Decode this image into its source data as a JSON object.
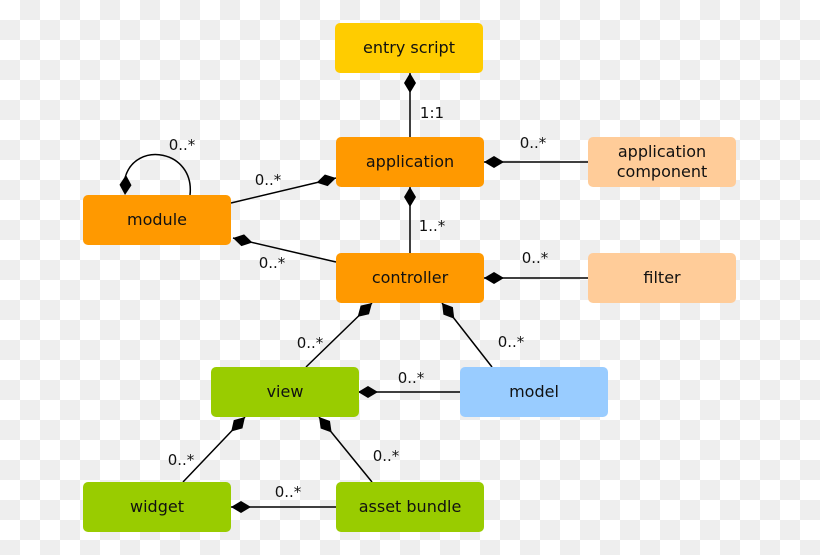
{
  "nodes": [
    {
      "id": "entry",
      "label": "entry script",
      "color": "#ffcc00"
    },
    {
      "id": "application",
      "label": "application",
      "color": "#ff9900"
    },
    {
      "id": "appcomp",
      "label": "application\ncomponent",
      "color": "#ffcc99"
    },
    {
      "id": "module",
      "label": "module",
      "color": "#ff9900"
    },
    {
      "id": "controller",
      "label": "controller",
      "color": "#ff9900"
    },
    {
      "id": "filter",
      "label": "filter",
      "color": "#ffcc99"
    },
    {
      "id": "view",
      "label": "view",
      "color": "#99cc00"
    },
    {
      "id": "model",
      "label": "model",
      "color": "#99ccff"
    },
    {
      "id": "widget",
      "label": "widget",
      "color": "#99cc00"
    },
    {
      "id": "asset",
      "label": "asset bundle",
      "color": "#99cc00"
    }
  ],
  "edges": [
    {
      "whole": "entry",
      "part": "application",
      "multiplicity": "1:1"
    },
    {
      "whole": "application",
      "part": "appcomp",
      "multiplicity": "0..*"
    },
    {
      "whole": "application",
      "part": "module",
      "multiplicity": "0..*"
    },
    {
      "whole": "module",
      "part": "module",
      "multiplicity": "0..*"
    },
    {
      "whole": "application",
      "part": "controller",
      "multiplicity": "1..*"
    },
    {
      "whole": "module",
      "part": "controller",
      "multiplicity": "0..*"
    },
    {
      "whole": "controller",
      "part": "filter",
      "multiplicity": "0..*"
    },
    {
      "whole": "controller",
      "part": "view",
      "multiplicity": "0..*"
    },
    {
      "whole": "controller",
      "part": "model",
      "multiplicity": "0..*"
    },
    {
      "whole": "view",
      "part": "model",
      "multiplicity": "0..*"
    },
    {
      "whole": "view",
      "part": "widget",
      "multiplicity": "0..*"
    },
    {
      "whole": "view",
      "part": "asset",
      "multiplicity": "0..*"
    },
    {
      "whole": "widget",
      "part": "asset",
      "multiplicity": "0..*"
    }
  ]
}
